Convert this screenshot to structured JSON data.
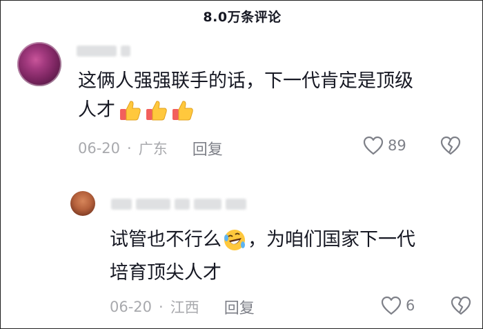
{
  "header": {
    "title": "8.0万条评论"
  },
  "comments": [
    {
      "text_line1": "这俩人强强联手的话，下一代肯定是顶级",
      "text_line2": "人才",
      "emoji": "thumbs-up x3",
      "date": "06-20",
      "separator": "·",
      "region": "广东",
      "reply_label": "回复",
      "likes": "89"
    },
    {
      "text_line1a": "试管也不行么",
      "text_line1b": "，为咱们国家下一代",
      "text_line2": "培育顶尖人才",
      "emoji": "rolling-on-floor-laughing",
      "date": "06-20",
      "separator": "·",
      "region": "江西",
      "reply_label": "回复",
      "likes": "6"
    }
  ],
  "colors": {
    "text": "#161823",
    "meta": "#a8a9ad",
    "action": "#7e8088",
    "blurred_name": "#dfe0e2"
  }
}
